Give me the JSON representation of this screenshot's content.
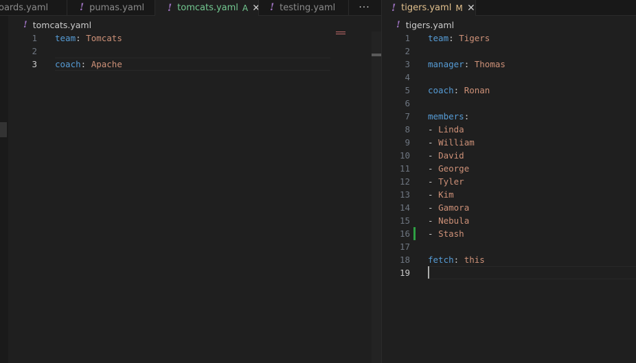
{
  "left_group": {
    "tabs": [
      {
        "label": "oards.yaml",
        "icon": "yaml-exclamation-icon",
        "active": false
      },
      {
        "label": "pumas.yaml",
        "icon": "yaml-exclamation-icon",
        "active": false
      },
      {
        "label": "tomcats.yaml",
        "icon": "yaml-exclamation-icon",
        "active": true,
        "status": "A"
      },
      {
        "label": "testing.yaml",
        "icon": "yaml-exclamation-icon",
        "active": false
      }
    ],
    "more_label": "···",
    "breadcrumb": "tomcats.yaml",
    "lines": [
      {
        "num": "1",
        "key": "team",
        "sep": ": ",
        "val": "Tomcats"
      },
      {
        "num": "2",
        "key": "",
        "sep": "",
        "val": ""
      },
      {
        "num": "3",
        "key": "coach",
        "sep": ": ",
        "val": "Apache"
      }
    ],
    "current_line": 3
  },
  "right_group": {
    "tab": {
      "label": "tigers.yaml",
      "icon": "yaml-exclamation-icon",
      "status": "M",
      "close": "✕"
    },
    "breadcrumb": "tigers.yaml",
    "lines": [
      {
        "num": "1",
        "key": "team",
        "sep": ": ",
        "val": "Tigers"
      },
      {
        "num": "2",
        "key": "",
        "sep": "",
        "val": ""
      },
      {
        "num": "3",
        "key": "manager",
        "sep": ": ",
        "val": "Thomas"
      },
      {
        "num": "4",
        "key": "",
        "sep": "",
        "val": ""
      },
      {
        "num": "5",
        "key": "coach",
        "sep": ": ",
        "val": "Ronan"
      },
      {
        "num": "6",
        "key": "",
        "sep": "",
        "val": ""
      },
      {
        "num": "7",
        "key": "members",
        "sep": ":",
        "val": ""
      },
      {
        "num": "8",
        "key": "",
        "sep": "- ",
        "val": "Linda"
      },
      {
        "num": "9",
        "key": "",
        "sep": "- ",
        "val": "William"
      },
      {
        "num": "10",
        "key": "",
        "sep": "- ",
        "val": "David"
      },
      {
        "num": "11",
        "key": "",
        "sep": "- ",
        "val": "George"
      },
      {
        "num": "12",
        "key": "",
        "sep": "- ",
        "val": "Tyler"
      },
      {
        "num": "13",
        "key": "",
        "sep": "- ",
        "val": "Kim"
      },
      {
        "num": "14",
        "key": "",
        "sep": "- ",
        "val": "Gamora"
      },
      {
        "num": "15",
        "key": "",
        "sep": "- ",
        "val": "Nebula"
      },
      {
        "num": "16",
        "key": "",
        "sep": "- ",
        "val": "Stash"
      },
      {
        "num": "17",
        "key": "",
        "sep": "",
        "val": ""
      },
      {
        "num": "18",
        "key": "fetch",
        "sep": ": ",
        "val": "this"
      },
      {
        "num": "19",
        "key": "",
        "sep": "",
        "val": ""
      }
    ],
    "current_line": 19,
    "added_line": 16
  },
  "colors": {
    "key": "#569cd6",
    "value": "#ce9178",
    "yaml_icon": "#a074c4",
    "added_status": "#73c991",
    "modified_status": "#e2c08d"
  }
}
